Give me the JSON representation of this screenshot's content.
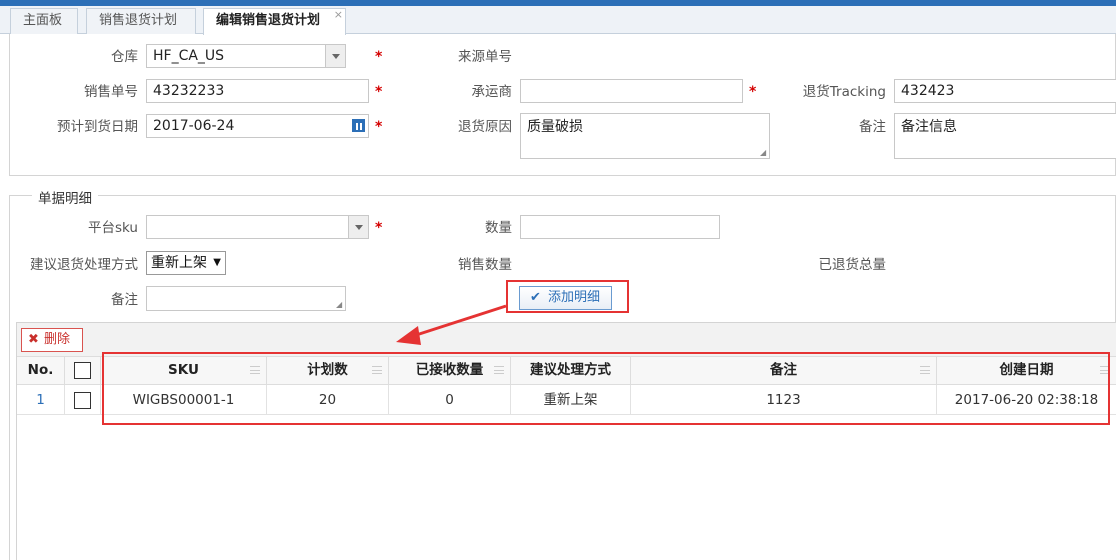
{
  "tabs": [
    {
      "label": "主面板"
    },
    {
      "label": "销售退货计划"
    },
    {
      "label": "编辑销售退货计划",
      "close": "×"
    }
  ],
  "form": {
    "warehouse_label": "仓库",
    "warehouse_value": "HF_CA_US",
    "source_no_label": "来源单号",
    "sales_no_label": "销售单号",
    "sales_no_value": "43232233",
    "carrier_label": "承运商",
    "carrier_value": "",
    "tracking_label": "退货Tracking",
    "tracking_value": "432423",
    "eta_label": "预计到货日期",
    "eta_value": "2017-06-24",
    "reason_label": "退货原因",
    "reason_value": "质量破损",
    "remark_label": "备注",
    "remark_value": "备注信息",
    "required_mark": "*"
  },
  "detail": {
    "legend": "单据明细",
    "sku_label": "平台sku",
    "sku_value": "",
    "qty_label": "数量",
    "qty_value": "",
    "method_label": "建议退货处理方式",
    "method_value": "重新上架",
    "method_arrow": "▼",
    "sales_qty_label": "销售数量",
    "returned_total_label": "已退货总量",
    "remark_label": "备注",
    "remark_value": "",
    "add_button": "添加明细",
    "add_icon": "✔"
  },
  "grid": {
    "delete_button": "删除",
    "delete_icon": "✖",
    "columns": [
      "No.",
      "SKU",
      "计划数",
      "已接收数量",
      "建议处理方式",
      "备注",
      "创建日期"
    ],
    "rows": [
      {
        "no": "1",
        "sku": "WIGBS00001-1",
        "plan": "20",
        "received": "0",
        "method": "重新上架",
        "remark": "1123",
        "created": "2017-06-20 02:38:18"
      }
    ]
  },
  "colors": {
    "accent": "#2c6fb7",
    "highlight": "#e53333",
    "required": "#d40000"
  }
}
